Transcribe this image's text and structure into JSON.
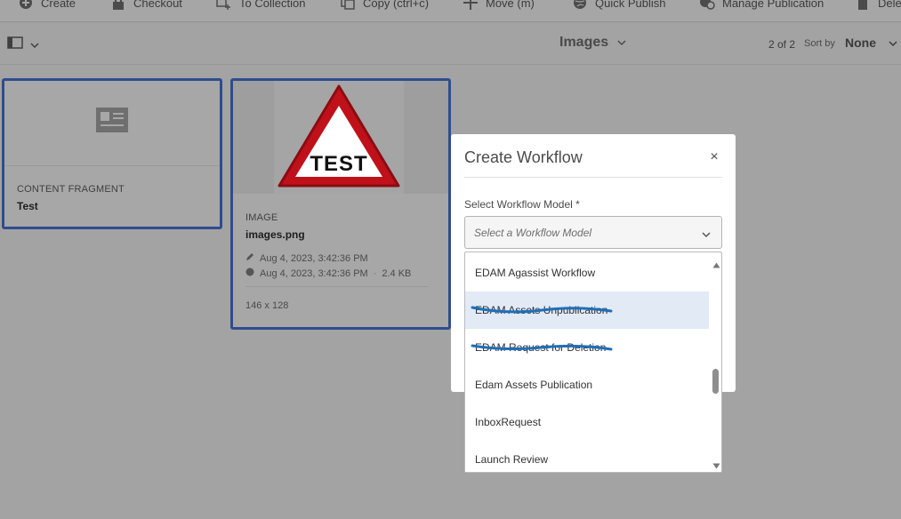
{
  "toolbar": {
    "items": [
      {
        "label": "Create",
        "icon": "plus-circle-icon"
      },
      {
        "label": "Checkout",
        "icon": "lock-icon"
      },
      {
        "label": "To Collection",
        "icon": "collection-add-icon"
      },
      {
        "label": "Copy (ctrl+c)",
        "icon": "copy-icon"
      },
      {
        "label": "Move (m)",
        "icon": "move-icon"
      },
      {
        "label": "Quick Publish",
        "icon": "globe-icon"
      },
      {
        "label": "Manage Publication",
        "icon": "globe-clock-icon"
      },
      {
        "label": "Dele",
        "icon": "trash-icon"
      }
    ]
  },
  "header": {
    "view_title": "Images",
    "page_count": "2 of 2",
    "sort_label": "Sort by",
    "sort_value": "None"
  },
  "cards": [
    {
      "type": "CONTENT FRAGMENT",
      "title": "Test"
    },
    {
      "type": "IMAGE",
      "title": "images.png",
      "modified": "Aug 4, 2023, 3:42:36 PM",
      "published": "Aug 4, 2023, 3:42:36 PM",
      "size": "2.4 KB",
      "dimensions": "146 x 128",
      "thumbnail_text": "TEST"
    }
  ],
  "dialog": {
    "title": "Create Workflow",
    "close_label": "×",
    "field_label": "Select Workflow Model *",
    "select_placeholder": "Select a Workflow Model",
    "options": [
      "EDAM Agassist Workflow",
      "EDAM Assets Unpublication",
      "EDAM Request for Deletion",
      "Edam Assets Publication",
      "InboxRequest",
      "Launch Review"
    ]
  },
  "colors": {
    "selection_border": "#2e4d8f",
    "highlight": "#e2eaf6",
    "scribble": "#1f6fb8",
    "sign_red": "#c0111b"
  }
}
